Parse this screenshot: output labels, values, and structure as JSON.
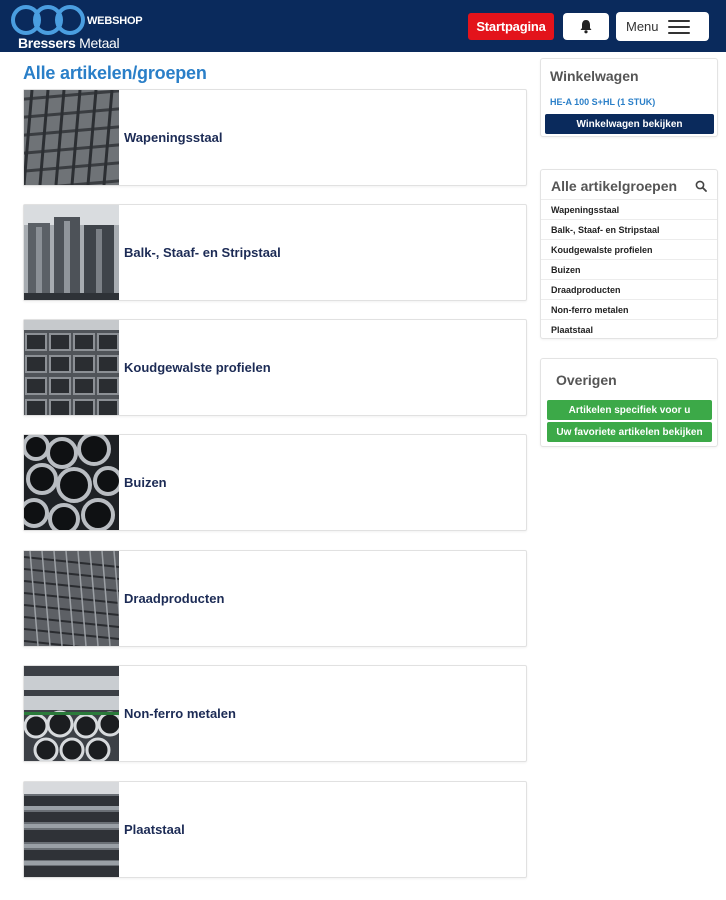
{
  "header": {
    "logo": {
      "webshop": "WEBSHOP",
      "name_bold": "Bressers",
      "name_rest": " Metaal"
    },
    "startpagina_label": "Startpagina",
    "bell_icon": "bell-icon",
    "menu_label": "Menu",
    "menu_icon": "hamburger-icon"
  },
  "main": {
    "title": "Alle artikelen/groepen",
    "categories": [
      {
        "label": "Wapeningsstaal",
        "image": "rebar-mesh"
      },
      {
        "label": "Balk-, Staaf- en Stripstaal",
        "image": "steel-beams"
      },
      {
        "label": "Koudgewalste profielen",
        "image": "rectangular-tubes"
      },
      {
        "label": "Buizen",
        "image": "round-pipes"
      },
      {
        "label": "Draadproducten",
        "image": "wire-mesh"
      },
      {
        "label": "Non-ferro metalen",
        "image": "aluminium-pipes"
      },
      {
        "label": "Plaatstaal",
        "image": "steel-plates"
      }
    ]
  },
  "sidebar": {
    "cart": {
      "title": "Winkelwagen",
      "item": "HE-A 100 S+HL (1 STUK)",
      "button": "Winkelwagen bekijken"
    },
    "groups": {
      "title": "Alle artikelgroepen",
      "items": [
        "Wapeningsstaal",
        "Balk-, Staaf- en Stripstaal",
        "Koudgewalste profielen",
        "Buizen",
        "Draadproducten",
        "Non-ferro metalen",
        "Plaatstaal"
      ]
    },
    "other": {
      "title": "Overigen",
      "buttons": [
        "Artikelen specifiek voor u",
        "Uw favoriete artikelen bekijken"
      ]
    }
  },
  "colors": {
    "header_bg": "#0a2a5c",
    "accent_red": "#e3131b",
    "accent_blue": "#2a7fc8",
    "accent_green": "#3ca948"
  }
}
